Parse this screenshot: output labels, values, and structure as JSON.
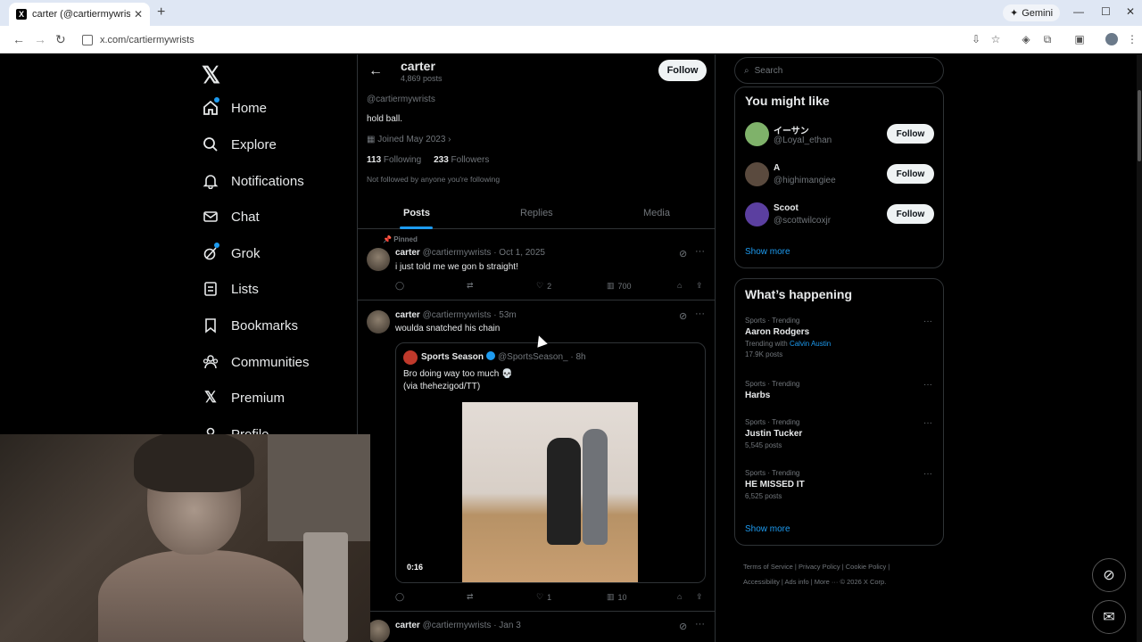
{
  "browser": {
    "tab_title": "carter (@cartiermywrists) / X",
    "tab_favicon": "X",
    "url": "x.com/cartiermywrists",
    "gemini_label": "Gemini"
  },
  "nav": {
    "items": [
      {
        "label": "Home",
        "icon": "home-icon"
      },
      {
        "label": "Explore",
        "icon": "search-icon"
      },
      {
        "label": "Notifications",
        "icon": "bell-icon"
      },
      {
        "label": "Chat",
        "icon": "mail-icon"
      },
      {
        "label": "Grok",
        "icon": "grok-icon"
      },
      {
        "label": "Lists",
        "icon": "list-icon"
      },
      {
        "label": "Bookmarks",
        "icon": "bookmark-icon"
      },
      {
        "label": "Communities",
        "icon": "people-icon"
      },
      {
        "label": "Premium",
        "icon": "x-icon"
      },
      {
        "label": "Profile",
        "icon": "person-icon"
      }
    ]
  },
  "profile": {
    "name": "carter",
    "post_count": "4,869 posts",
    "follow_label": "Follow",
    "handle": "@cartiermywrists",
    "bio": "hold ball.",
    "joined": "Joined May 2023",
    "following_count": "113",
    "following_label": "Following",
    "followers_count": "233",
    "followers_label": "Followers",
    "not_followed": "Not followed by anyone you're following"
  },
  "tabs": [
    "Posts",
    "Replies",
    "Media"
  ],
  "posts": [
    {
      "pinned": "Pinned",
      "name": "carter",
      "meta": "@cartiermywrists · Oct 1, 2025",
      "text": "i just told me we gon b straight!",
      "likes": "2",
      "views": "700"
    },
    {
      "name": "carter",
      "meta": "@cartiermywrists · 53m",
      "text": "woulda snatched his chain",
      "quote": {
        "name": "Sports Season",
        "meta": "@SportsSeason_ · 8h",
        "line1": "Bro doing way too much 💀",
        "line2": "(via thehezigod/TT)",
        "video_time": "0:16"
      },
      "likes": "1",
      "views": "10"
    },
    {
      "name": "carter",
      "meta": "@cartiermywrists · Jan 3"
    }
  ],
  "sidebar": {
    "search_placeholder": "Search",
    "might_like_title": "You might like",
    "suggestions": [
      {
        "name": "イーサン",
        "handle": "@LoyaI_ethan",
        "color": "#7fb26a"
      },
      {
        "name": "A",
        "handle": "@highimangiee",
        "color": "#5a4a3e"
      },
      {
        "name": "Scoot",
        "handle": "@scottwilcoxjr",
        "color": "#5b3fa0"
      }
    ],
    "suggestion_follow": "Follow",
    "show_more": "Show more",
    "happening_title": "What’s happening",
    "trends": [
      {
        "category": "Sports · Trending",
        "name": "Aaron Rodgers",
        "sub_prefix": "Trending with ",
        "sub_link": "Calvin Austin",
        "sub2": "17.9K posts"
      },
      {
        "category": "Sports · Trending",
        "name": "Harbs",
        "sub_prefix": "",
        "sub_link": "",
        "sub2": ""
      },
      {
        "category": "Sports · Trending",
        "name": "Justin Tucker",
        "sub_prefix": "",
        "sub_link": "",
        "sub2": "5,545 posts"
      },
      {
        "category": "Sports · Trending",
        "name": "HE MISSED IT",
        "sub_prefix": "",
        "sub_link": "",
        "sub2": "6,525 posts"
      }
    ],
    "footer_line1": "Terms of Service  |  Privacy Policy  |  Cookie Policy  |",
    "footer_line2": "Accessibility  |  Ads info  |  More ···  © 2026 X Corp."
  },
  "colors": {
    "accent": "#1d9bf0",
    "background": "#000000",
    "border": "#2f3336",
    "muted": "#71767b"
  }
}
